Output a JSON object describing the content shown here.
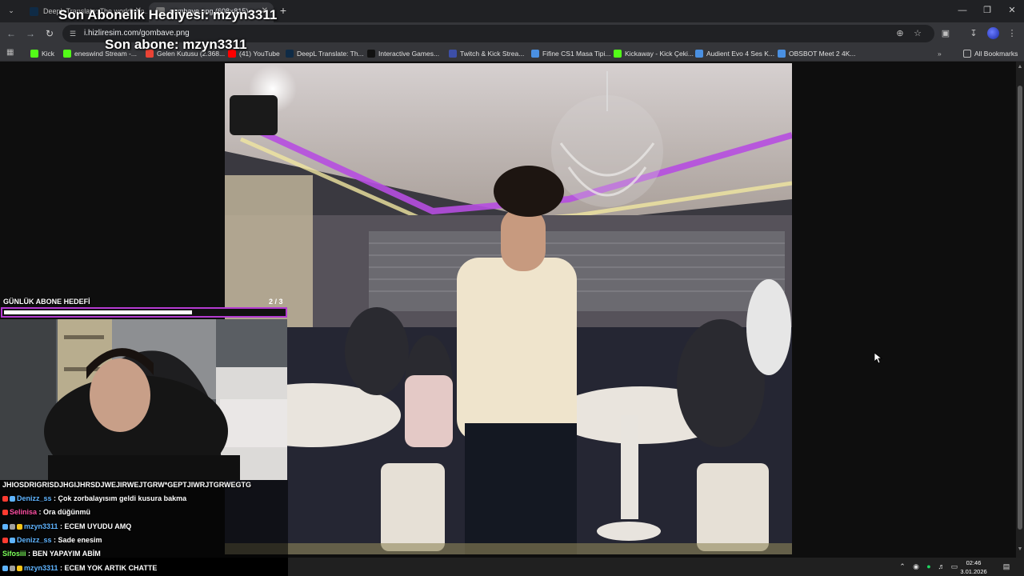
{
  "browser": {
    "tabs": [
      {
        "title": "DeepL Translate: The world's m...",
        "active": false
      },
      {
        "title": "gombave.png (608×815)",
        "active": true
      }
    ],
    "url": "i.hizliresim.com/gombave.png",
    "bookmarks": [
      "Kick",
      "eneswind Stream -...",
      "Gelen Kutusu (2.368...",
      "(41) YouTube",
      "DeepL Translate: Th...",
      "Interactive Games...",
      "Twitch & Kick Strea...",
      "Fifine CS1 Masa Tipi...",
      "Kickaway - Kick Çeki...",
      "Audient Evo 4 Ses K...",
      "OBSBOT Meet 2 4K..."
    ],
    "all_bookmarks": "All Bookmarks"
  },
  "overlay": {
    "gift_sub": "Son Abonelik Hediyesi: mzyn3311",
    "last_sub": "Son abone: mzyn3311",
    "goal": {
      "label": "GÜNLÜK ABONE HEDEFİ",
      "count": "2 / 3",
      "progress": 0.67
    }
  },
  "chat": [
    {
      "user": "",
      "message": "JHIOSDRIGRISDJHGIJHRSDJWEJIRWEJTGRW*GEPTJIWRJTGRWEGTG",
      "color": "#ffffff"
    },
    {
      "user": "Denizz_ss",
      "message": " : Çok zorbalayısım geldi kusura bakma",
      "color": "#5fb4ff"
    },
    {
      "user": "Selinisa",
      "message": " : Ora düğünmü",
      "color": "#ff4fa3"
    },
    {
      "user": "mzyn3311",
      "message": " : ECEM UYUDU AMQ",
      "color": "#5fb4ff"
    },
    {
      "user": "Denizz_ss",
      "message": " : Sade enesim",
      "color": "#5fb4ff"
    },
    {
      "user": "Sifosiii",
      "message": " : BEN YAPAYIM ABİM",
      "color": "#7cff5a"
    },
    {
      "user": "mzyn3311",
      "message": " : ECEM YOK ARTIK CHATTE",
      "color": "#5fb4ff"
    }
  ],
  "taskbar": {
    "time": "02:46",
    "date": "3.01.2026"
  },
  "colors": {
    "goal_border": "#b43bd1",
    "chrome_bg": "#35363a",
    "tab_strip": "#202124"
  }
}
